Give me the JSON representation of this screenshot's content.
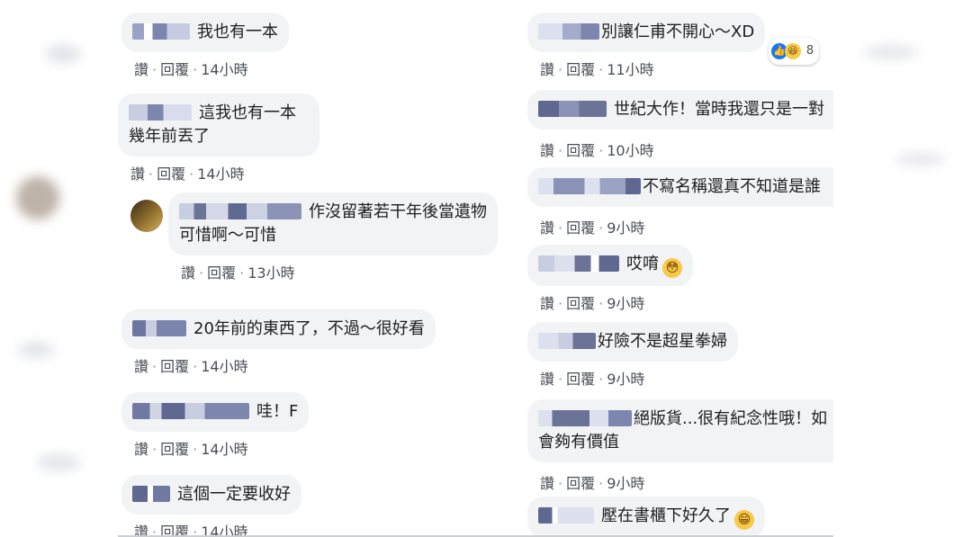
{
  "action_labels": {
    "like": "讚",
    "reply": "回覆",
    "separator": "·"
  },
  "left_comments": [
    {
      "text": "我也有一本",
      "time": "14小時"
    },
    {
      "text": "這我也有一本",
      "text2": "幾年前丟了",
      "time": "14小時"
    },
    {
      "text": "作沒留著若干年後當遺物",
      "text2": "可惜啊～可惜",
      "time": "13小時"
    },
    {
      "text": "20年前的東西了，不過～很好看",
      "time": "14小時"
    },
    {
      "text": "哇！F",
      "time": "14小時"
    },
    {
      "text": "這個一定要收好",
      "time": "14小時"
    }
  ],
  "right_comments": [
    {
      "text": "別讓仁甫不開心～XD",
      "time": "11小時",
      "reaction_count": "8"
    },
    {
      "text": "世紀大作！當時我還只是一對",
      "time": "10小時"
    },
    {
      "text": "不寫名稱還真不知道是誰",
      "time": "9小時"
    },
    {
      "text": "哎唷",
      "time": "9小時",
      "emoji": "😳"
    },
    {
      "text": "好險不是超星拳婦",
      "time": "9小時"
    },
    {
      "text": "絕版貨...很有紀念性哦！如",
      "text2": "會夠有價值",
      "time": "9小時"
    },
    {
      "text": "壓在書櫃下好久了",
      "time": "",
      "emoji": "😁"
    }
  ],
  "colors": {
    "bubble": "#f2f3f5",
    "meta": "#4b4f56",
    "like_blue": "#1877f2"
  }
}
